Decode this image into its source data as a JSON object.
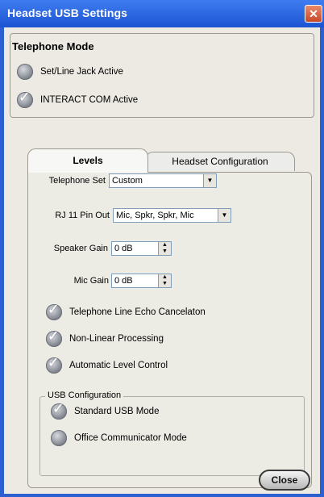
{
  "window": {
    "title": "Headset USB Settings",
    "close_glyph": "✕"
  },
  "telephone_mode": {
    "title": "Telephone Mode",
    "options": [
      {
        "label": "Set/Line Jack Active",
        "checked": false
      },
      {
        "label": "INTERACT COM Active",
        "checked": true
      }
    ]
  },
  "tabs": [
    {
      "label": "Levels",
      "active": true
    },
    {
      "label": "Headset Configuration",
      "active": false
    }
  ],
  "levels": {
    "telephone_set": {
      "label": "Telephone Set",
      "value": "Custom"
    },
    "rj11_pinout": {
      "label": "RJ 11 Pin Out",
      "value": "Mic, Spkr, Spkr, Mic"
    },
    "speaker_gain": {
      "label": "Speaker Gain",
      "value": "0 dB"
    },
    "mic_gain": {
      "label": "Mic Gain",
      "value": "0 dB"
    },
    "checks": [
      {
        "label": "Telephone Line Echo Cancelaton",
        "checked": true
      },
      {
        "label": "Non-Linear Processing",
        "checked": true
      },
      {
        "label": "Automatic Level Control",
        "checked": true
      }
    ],
    "usb": {
      "title": "USB Configuration",
      "options": [
        {
          "label": "Standard USB Mode",
          "checked": true
        },
        {
          "label": "Office Communicator Mode",
          "checked": false
        }
      ]
    }
  },
  "footer": {
    "close_label": "Close"
  },
  "icons": {
    "check": "check-icon",
    "dropdown": "chevron-down-icon",
    "spin": "spinner-icon"
  }
}
